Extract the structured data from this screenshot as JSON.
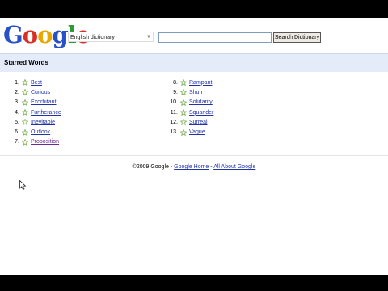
{
  "header": {
    "logo_letters": [
      "G",
      "o",
      "o",
      "g",
      "l",
      "e"
    ],
    "dictionary_select": "English dictionary",
    "search_value": "",
    "search_button": "Search Dictionary"
  },
  "section": {
    "title": "Starred Words"
  },
  "starred_words": {
    "left": [
      {
        "num": "1.",
        "word": "Best"
      },
      {
        "num": "2.",
        "word": "Curious"
      },
      {
        "num": "3.",
        "word": "Exorbitant"
      },
      {
        "num": "4.",
        "word": "Furtherance"
      },
      {
        "num": "5.",
        "word": "Inevitable"
      },
      {
        "num": "6.",
        "word": "Outlook"
      },
      {
        "num": "7.",
        "word": "Proposition"
      }
    ],
    "right": [
      {
        "num": "8.",
        "word": "Rampant"
      },
      {
        "num": "9.",
        "word": "Shun"
      },
      {
        "num": "10.",
        "word": "Solidarity"
      },
      {
        "num": "11.",
        "word": "Squander"
      },
      {
        "num": "12.",
        "word": "Surreal"
      },
      {
        "num": "13.",
        "word": "Vague"
      }
    ]
  },
  "footer": {
    "copyright": "©2009 Google",
    "sep1": " - ",
    "home_link": "Google Home",
    "sep2": " - ",
    "about_link": "All About Google"
  },
  "icons": {
    "star": "star-icon",
    "dropdown": "chevron-down-icon",
    "cursor": "mouse-pointer-icon"
  },
  "colors": {
    "link": "#2233aa",
    "visited": "#6b2c91",
    "section_bg": "#e5ecf9",
    "star": "#6aa84f"
  }
}
